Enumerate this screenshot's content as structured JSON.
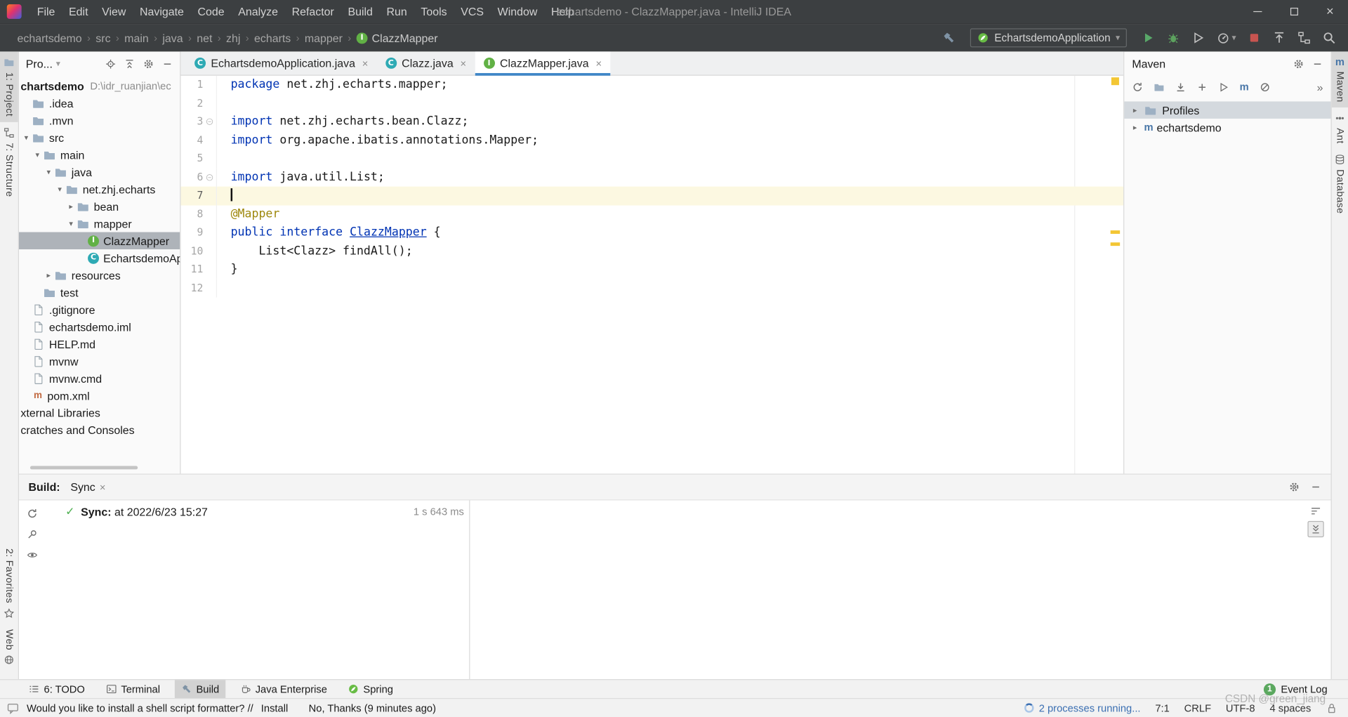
{
  "window": {
    "title": "echartsdemo - ClazzMapper.java - IntelliJ IDEA",
    "menus": [
      "File",
      "Edit",
      "View",
      "Navigate",
      "Code",
      "Analyze",
      "Refactor",
      "Build",
      "Run",
      "Tools",
      "VCS",
      "Window",
      "Help"
    ]
  },
  "navbar": {
    "breadcrumbs": [
      "echartsdemo",
      "src",
      "main",
      "java",
      "net",
      "zhj",
      "echarts",
      "mapper",
      "ClazzMapper"
    ],
    "run_config": "EchartsdemoApplication"
  },
  "left_stripe": {
    "project": "1: Project",
    "structure": "7: Structure",
    "favorites": "2: Favorites",
    "web": "Web"
  },
  "right_stripe": {
    "maven": "Maven",
    "ant": "Ant",
    "database": "Database"
  },
  "project_panel": {
    "header": "Pro...",
    "tree": [
      {
        "label": "chartsdemo",
        "extra": "D:\\idr_ruanjian\\ec",
        "icon": "none",
        "indent": 0,
        "bold": true
      },
      {
        "label": ".idea",
        "icon": "folder",
        "indent": 1
      },
      {
        "label": ".mvn",
        "icon": "folder",
        "indent": 1
      },
      {
        "label": "src",
        "icon": "folder",
        "indent": 1,
        "arrow": "down"
      },
      {
        "label": "main",
        "icon": "folder",
        "indent": 2,
        "arrow": "down"
      },
      {
        "label": "java",
        "icon": "folder",
        "indent": 3,
        "arrow": "down"
      },
      {
        "label": "net.zhj.echarts",
        "icon": "folder",
        "indent": 4,
        "arrow": "down"
      },
      {
        "label": "bean",
        "icon": "folder",
        "indent": 5,
        "arrow": "right"
      },
      {
        "label": "mapper",
        "icon": "folder",
        "indent": 5,
        "arrow": "down"
      },
      {
        "label": "ClazzMapper",
        "icon": "interface",
        "indent": 6,
        "selected": true
      },
      {
        "label": "EchartsdemoApplication",
        "icon": "class",
        "indent": 6
      },
      {
        "label": "resources",
        "icon": "folder",
        "indent": 3,
        "arrow": "right"
      },
      {
        "label": "test",
        "icon": "folder",
        "indent": 2
      },
      {
        "label": ".gitignore",
        "icon": "file",
        "indent": 1
      },
      {
        "label": "echartsdemo.iml",
        "icon": "file",
        "indent": 1
      },
      {
        "label": "HELP.md",
        "icon": "file",
        "indent": 1
      },
      {
        "label": "mvnw",
        "icon": "file",
        "indent": 1
      },
      {
        "label": "mvnw.cmd",
        "icon": "file",
        "indent": 1
      },
      {
        "label": "pom.xml",
        "icon": "maven",
        "indent": 1
      },
      {
        "label": "xternal Libraries",
        "icon": "none",
        "indent": 0
      },
      {
        "label": "cratches and Consoles",
        "icon": "none",
        "indent": 0
      }
    ]
  },
  "editor": {
    "tabs": [
      {
        "label": "EchartsdemoApplication.java",
        "icon": "class",
        "active": false
      },
      {
        "label": "Clazz.java",
        "icon": "class",
        "active": false
      },
      {
        "label": "ClazzMapper.java",
        "icon": "interface",
        "active": true
      }
    ],
    "lines": [
      {
        "num": "1",
        "seg": [
          [
            "kw",
            "package"
          ],
          [
            "p",
            " net.zhj.echarts.mapper;"
          ]
        ]
      },
      {
        "num": "2",
        "seg": []
      },
      {
        "num": "3",
        "fold": true,
        "seg": [
          [
            "kw",
            "import"
          ],
          [
            "p",
            " net.zhj.echarts.bean.Clazz;"
          ]
        ]
      },
      {
        "num": "4",
        "seg": [
          [
            "kw",
            "import"
          ],
          [
            "p",
            " org.apache.ibatis.annotations.Mapper;"
          ]
        ]
      },
      {
        "num": "5",
        "seg": []
      },
      {
        "num": "6",
        "fold": true,
        "seg": [
          [
            "kw",
            "import"
          ],
          [
            "p",
            " java.util.List;"
          ]
        ]
      },
      {
        "num": "7",
        "active": true,
        "caret": true,
        "seg": []
      },
      {
        "num": "8",
        "seg": [
          [
            "ann",
            "@Mapper"
          ]
        ]
      },
      {
        "num": "9",
        "seg": [
          [
            "kw",
            "public"
          ],
          [
            "p",
            " "
          ],
          [
            "kw",
            "interface"
          ],
          [
            "p",
            " "
          ],
          [
            "ref",
            "ClazzMapper"
          ],
          [
            "p",
            " {"
          ]
        ]
      },
      {
        "num": "10",
        "seg": [
          [
            "p",
            "    List<Clazz> findAll();"
          ]
        ]
      },
      {
        "num": "11",
        "seg": [
          [
            "p",
            "}"
          ]
        ]
      },
      {
        "num": "12",
        "seg": []
      }
    ]
  },
  "maven_panel": {
    "title": "Maven",
    "tree": [
      {
        "label": "Profiles",
        "icon": "folder",
        "selected": true
      },
      {
        "label": "echartsdemo",
        "icon": "maven",
        "selected": false
      }
    ]
  },
  "build_panel": {
    "label": "Build:",
    "tab": "Sync",
    "sync_label": "Sync:",
    "sync_text": " at 2022/6/23 15:27",
    "duration": "1 s 643 ms"
  },
  "status_bar": {
    "buttons": [
      {
        "label": "6: TODO",
        "icon": "todo"
      },
      {
        "label": "Terminal",
        "icon": "terminal"
      },
      {
        "label": "Build",
        "icon": "hammer",
        "active": true
      },
      {
        "label": "Java Enterprise",
        "icon": "coffee"
      },
      {
        "label": "Spring",
        "icon": "leaf"
      }
    ],
    "event_log": "Event Log",
    "notification_count": "1"
  },
  "message_bar": {
    "prompt": "Would you like to install a shell script formatter? //",
    "install": "Install",
    "no_thanks": "No, Thanks",
    "ago": "(9 minutes ago)",
    "processes": "2 processes running...",
    "caret": "7:1",
    "line_sep": "CRLF",
    "encoding": "UTF-8",
    "indent": "4 spaces",
    "watermark": "CSDN @green_jiang"
  },
  "glyphs": {
    "arrow_down": "▾",
    "arrow_right": "▸",
    "close": "×",
    "crumb_sep": "›",
    "dropdown": "▾",
    "chevron_more": "»",
    "check": "✓",
    "maven_letter": "m"
  },
  "colors": {
    "accent": "#3e86c7",
    "keyword": "#0033b3",
    "annotation": "#9e880d",
    "run_green": "#59a869",
    "stop_red": "#c75450",
    "caret_line": "#fcf8e1",
    "stripe_mark": "#f3c634",
    "tree_selection": "#aeb3b9"
  }
}
